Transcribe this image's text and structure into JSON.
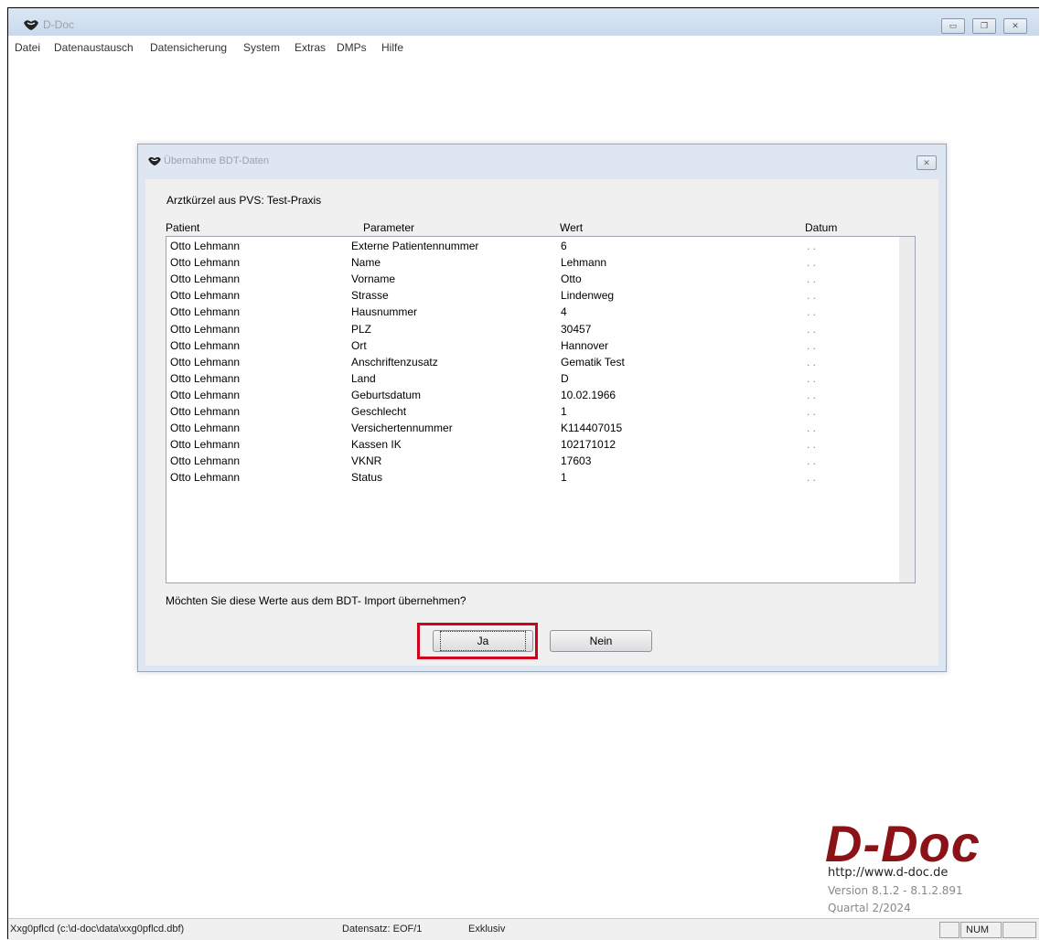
{
  "window": {
    "title": "D-Doc"
  },
  "menu": [
    "Datei",
    "Datenaustausch",
    "Datensicherung",
    "System",
    "Extras",
    "DMPs",
    "Hilfe"
  ],
  "dialog": {
    "title": "Übernahme BDT-Daten",
    "praxis": "Arztkürzel aus PVS: Test-Praxis",
    "columns": [
      "Patient",
      "Parameter",
      "Wert",
      "Datum"
    ],
    "rows": [
      [
        "Otto Lehmann",
        "Externe Patientennummer",
        "6",
        ". ."
      ],
      [
        "Otto Lehmann",
        "Name",
        "Lehmann",
        ". ."
      ],
      [
        "Otto Lehmann",
        "Vorname",
        "Otto",
        ". ."
      ],
      [
        "Otto Lehmann",
        "Strasse",
        "Lindenweg",
        ". ."
      ],
      [
        "Otto Lehmann",
        "Hausnummer",
        "4",
        ". ."
      ],
      [
        "Otto Lehmann",
        "PLZ",
        "30457",
        ". ."
      ],
      [
        "Otto Lehmann",
        "Ort",
        "Hannover",
        ". ."
      ],
      [
        "Otto Lehmann",
        "Anschriftenzusatz",
        "Gematik Test",
        ". ."
      ],
      [
        "Otto Lehmann",
        "Land",
        "D",
        ". ."
      ],
      [
        "Otto Lehmann",
        "Geburtsdatum",
        "10.02.1966",
        ". ."
      ],
      [
        "Otto Lehmann",
        "Geschlecht",
        "1",
        ". ."
      ],
      [
        "Otto Lehmann",
        "Versichertennummer",
        "K114407015",
        ". ."
      ],
      [
        "Otto Lehmann",
        "Kassen IK",
        "102171012",
        ". ."
      ],
      [
        "Otto Lehmann",
        "VKNR",
        "17603",
        ". ."
      ],
      [
        "Otto Lehmann",
        "Status",
        "1",
        ". ."
      ]
    ],
    "question": "Möchten Sie diese Werte aus dem BDT- Import übernehmen?",
    "yes_label": "Ja",
    "no_label": "Nein"
  },
  "branding": {
    "logo": "D-Doc",
    "url": "http://www.d-doc.de",
    "version": "Version 8.1.2 - 8.1.2.891",
    "quarter": "Quartal 2/2024"
  },
  "statusbar": {
    "file": "Xxg0pflcd (c:\\d-doc\\data\\xxg0pflcd.dbf)",
    "record": "Datensatz: EOF/1",
    "mode": "Exklusiv",
    "num": "NUM"
  },
  "colors": {
    "brand": "#8b1217",
    "highlight": "#d0021b"
  }
}
